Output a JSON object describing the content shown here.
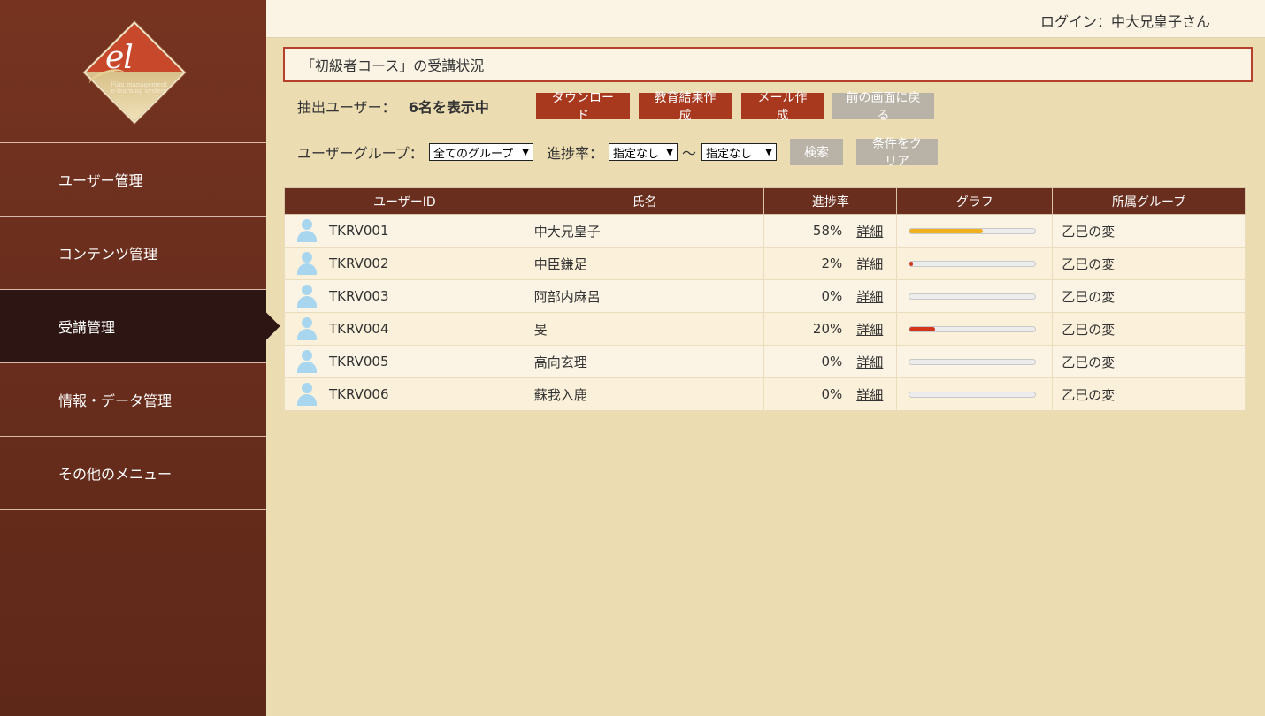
{
  "logo": {
    "text": "el",
    "sub": "Film management e-learning system"
  },
  "sidebar": {
    "items": [
      {
        "label": "ユーザー管理"
      },
      {
        "label": "コンテンツ管理"
      },
      {
        "label": "受講管理"
      },
      {
        "label": "情報・データ管理"
      },
      {
        "label": "その他のメニュー"
      }
    ],
    "active_index": 2
  },
  "header": {
    "login_text": "ログイン：中大兄皇子さん"
  },
  "page": {
    "title": "「初級者コース」の受講状況"
  },
  "summary": {
    "label": "抽出ユーザー：",
    "count": "6名を表示中"
  },
  "buttons": {
    "download": "ダウンロード",
    "edu_result": "教育結果作成",
    "mail": "メール作成",
    "back": "前の画面に戻る",
    "search": "検索",
    "clear": "条件をクリア"
  },
  "filters": {
    "group_label": "ユーザーグループ：",
    "group_value": "全てのグループ",
    "progress_label": "進捗率：",
    "progress_from": "指定なし",
    "range_sep": "〜",
    "progress_to": "指定なし"
  },
  "table": {
    "headers": [
      "ユーザーID",
      "氏名",
      "進捗率",
      "グラフ",
      "所属グループ"
    ],
    "detail_label": "詳細",
    "rows": [
      {
        "id": "TKRV001",
        "name": "中大兄皇子",
        "progress": "58%",
        "progress_value": 0.58,
        "bar_color": "#f0b020",
        "group": "乙巳の変"
      },
      {
        "id": "TKRV002",
        "name": "中臣鎌足",
        "progress": "2%",
        "progress_value": 0.02,
        "bar_color": "#d2361a",
        "group": "乙巳の変"
      },
      {
        "id": "TKRV003",
        "name": "阿部内麻呂",
        "progress": "0%",
        "progress_value": 0,
        "bar_color": "#d2361a",
        "group": "乙巳の変"
      },
      {
        "id": "TKRV004",
        "name": "旻",
        "progress": "20%",
        "progress_value": 0.2,
        "bar_color": "#d2361a",
        "group": "乙巳の変"
      },
      {
        "id": "TKRV005",
        "name": "高向玄理",
        "progress": "0%",
        "progress_value": 0,
        "bar_color": "#d2361a",
        "group": "乙巳の変"
      },
      {
        "id": "TKRV006",
        "name": "蘇我入鹿",
        "progress": "0%",
        "progress_value": 0,
        "bar_color": "#d2361a",
        "group": "乙巳の変"
      }
    ]
  },
  "colors": {
    "sidebar_bg": "#6a2e1e",
    "active_nav": "#2c1512",
    "accent_button": "#a8391f",
    "disabled_button": "#b9b2a6",
    "page_bg": "#ecdcb2",
    "user_icon": "#a9d6ef"
  },
  "icons": {
    "user": "user-icon",
    "dropdown": "chevron-down-icon"
  }
}
